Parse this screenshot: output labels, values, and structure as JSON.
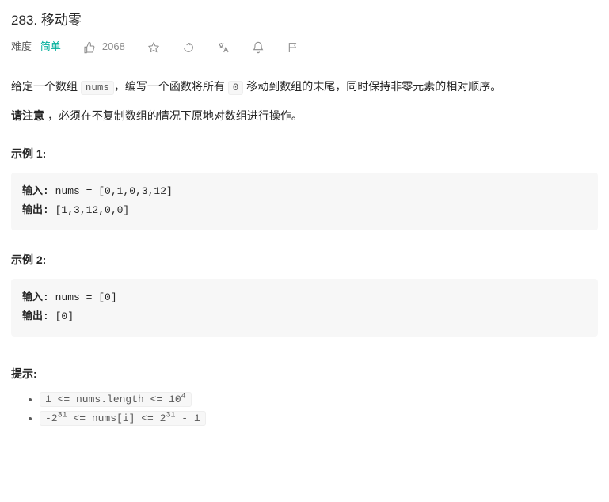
{
  "title": {
    "number": "283",
    "name": "移动零"
  },
  "meta": {
    "difficulty_label": "难度",
    "difficulty_value": "简单",
    "likes": "2068"
  },
  "desc": {
    "p1_pre": "给定一个数组 ",
    "p1_code": "nums",
    "p1_mid": "，编写一个函数将所有 ",
    "p1_code2": "0",
    "p1_post": " 移动到数组的末尾，同时保持非零元素的相对顺序。",
    "p2_bold": "请注意",
    "p2_rest": " ，必须在不复制数组的情况下原地对数组进行操作。"
  },
  "examples": [
    {
      "title": "示例 1:",
      "in_label": "输入:",
      "in_val": " nums = [0,1,0,3,12]",
      "out_label": "输出:",
      "out_val": " [1,3,12,0,0]"
    },
    {
      "title": "示例 2:",
      "in_label": "输入:",
      "in_val": " nums = [0]",
      "out_label": "输出:",
      "out_val": " [0]"
    }
  ],
  "hints": {
    "title": "提示:",
    "c1_a": "1 <= nums.length <= 10",
    "c1_sup": "4",
    "c2_a": "-2",
    "c2_sup1": "31",
    "c2_b": "  <= nums[i] <= 2",
    "c2_sup2": "31",
    "c2_c": "  - 1"
  }
}
